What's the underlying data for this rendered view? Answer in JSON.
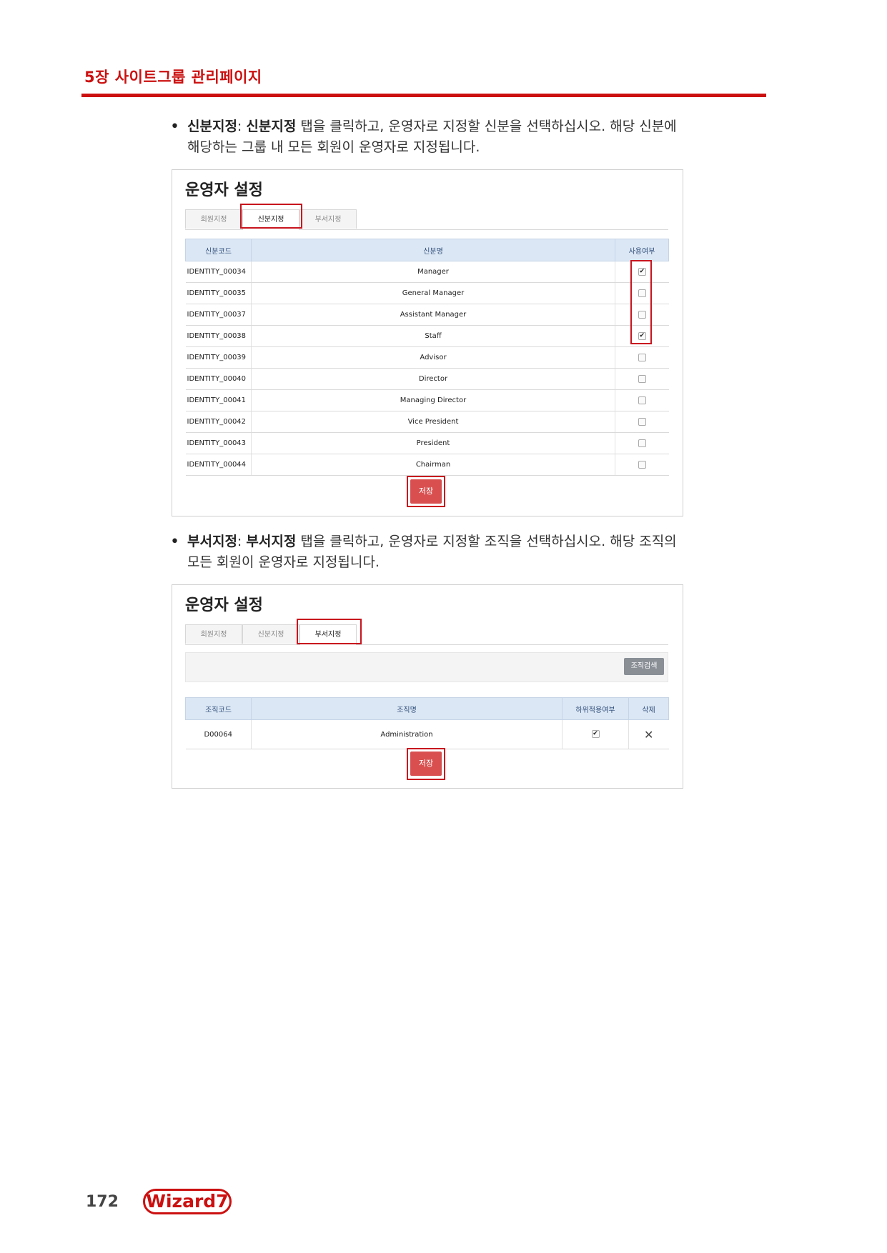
{
  "header": {
    "chapter": "5장 사이트그룹 관리페이지"
  },
  "section1": {
    "bold1": "신분지정",
    "colon": ": ",
    "bold2": "신분지정",
    "text_line1": " 탭을 클릭하고, 운영자로 지정할 신분을 선택하십시오. 해당 신분에",
    "text_line2": "해당하는 그룹 내 모든 회원이 운영자로 지정됩니다."
  },
  "panel1": {
    "title": "운영자 설정",
    "tabs": [
      "회원지정",
      "신분지정",
      "부서지정"
    ],
    "columns": [
      "신분코드",
      "신분명",
      "사용여부"
    ],
    "rows": [
      {
        "code": "IDENTITY_00034",
        "name": "Manager",
        "checked": "✔"
      },
      {
        "code": "IDENTITY_00035",
        "name": "General Manager",
        "checked": ""
      },
      {
        "code": "IDENTITY_00037",
        "name": "Assistant Manager",
        "checked": ""
      },
      {
        "code": "IDENTITY_00038",
        "name": "Staff",
        "checked": "✔"
      },
      {
        "code": "IDENTITY_00039",
        "name": "Advisor",
        "checked": ""
      },
      {
        "code": "IDENTITY_00040",
        "name": "Director",
        "checked": ""
      },
      {
        "code": "IDENTITY_00041",
        "name": "Managing Director",
        "checked": ""
      },
      {
        "code": "IDENTITY_00042",
        "name": "Vice President",
        "checked": ""
      },
      {
        "code": "IDENTITY_00043",
        "name": "President",
        "checked": ""
      },
      {
        "code": "IDENTITY_00044",
        "name": "Chairman",
        "checked": ""
      }
    ],
    "save_label": "저장"
  },
  "section2": {
    "bold1": "부서지정",
    "colon": ": ",
    "bold2": "부서지정",
    "text_line1": " 탭을 클릭하고, 운영자로 지정할 조직을 선택하십시오. 해당 조직의",
    "text_line2": "모든 회원이 운영자로 지정됩니다."
  },
  "panel2": {
    "title": "운영자 설정",
    "tabs": [
      "회원지정",
      "신분지정",
      "부서지정"
    ],
    "search_label": "조직검색",
    "columns": [
      "조직코드",
      "조직명",
      "하위적용여부",
      "삭제"
    ],
    "rows": [
      {
        "code": "D00064",
        "name": "Administration",
        "checked": "✔",
        "delete": "✕"
      }
    ],
    "save_label": "저장"
  },
  "footer": {
    "page_number": "172",
    "logo_text": "Wizard7"
  }
}
